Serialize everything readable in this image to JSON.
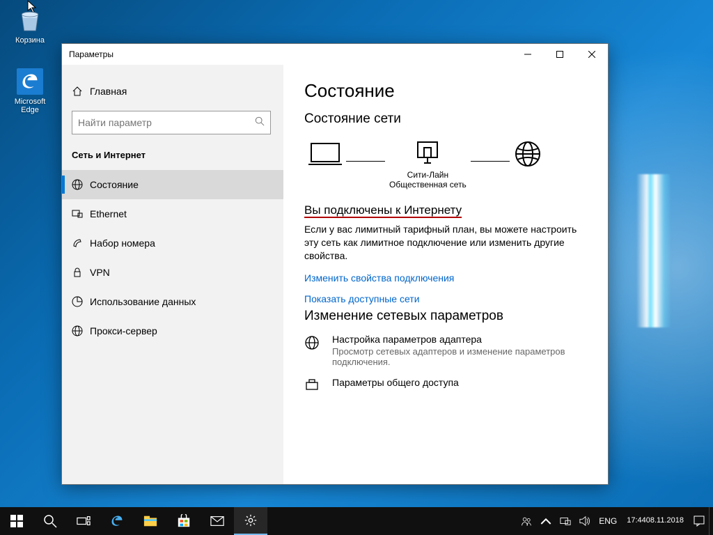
{
  "desktop": {
    "recycle_bin": "Корзина",
    "edge": "Microsoft Edge"
  },
  "window": {
    "title": "Параметры",
    "home_label": "Главная",
    "search_placeholder": "Найти параметр",
    "section_title": "Сеть и Интернет",
    "nav": {
      "status": "Состояние",
      "ethernet": "Ethernet",
      "dialup": "Набор номера",
      "vpn": "VPN",
      "data_usage": "Использование данных",
      "proxy": "Прокси-сервер"
    }
  },
  "content": {
    "page_title": "Состояние",
    "net_state_title": "Состояние сети",
    "network_name": "Сити-Лайн",
    "network_type": "Общественная сеть",
    "connected_heading": "Вы подключены к Интернету",
    "connected_body": "Если у вас лимитный тарифный план, вы можете настроить эту сеть как лимитное подключение или изменить другие свойства.",
    "link_change_props": "Изменить свойства подключения",
    "link_show_nets": "Показать доступные сети",
    "change_settings_title": "Изменение сетевых параметров",
    "adapter_title": "Настройка параметров адаптера",
    "adapter_desc": "Просмотр сетевых адаптеров и изменение параметров подключения.",
    "sharing_title": "Параметры общего доступа"
  },
  "taskbar": {
    "language": "ENG",
    "time": "17:44",
    "date": "08.11.2018"
  }
}
